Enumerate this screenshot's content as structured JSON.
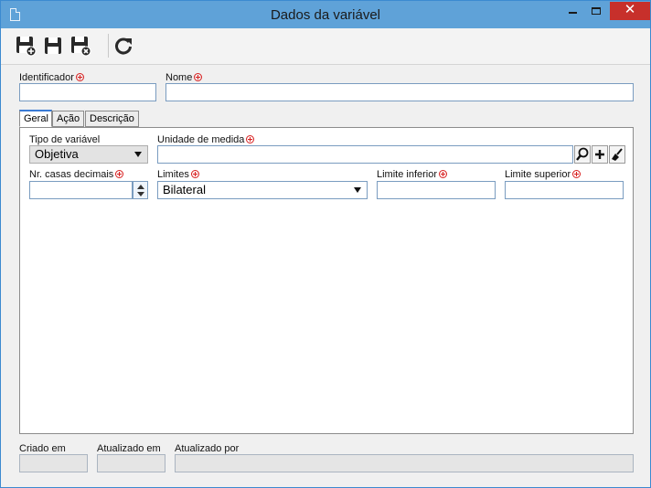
{
  "window": {
    "title": "Dados da variável"
  },
  "toolbar": {
    "icons": [
      "save-new-icon",
      "save-icon",
      "save-close-icon",
      "refresh-icon"
    ]
  },
  "header": {
    "identificador_label": "Identificador",
    "identificador_value": "",
    "nome_label": "Nome",
    "nome_value": ""
  },
  "tabs": [
    {
      "label": "Geral",
      "active": true
    },
    {
      "label": "Ação",
      "active": false
    },
    {
      "label": "Descrição",
      "active": false
    }
  ],
  "geral": {
    "tipo_label": "Tipo de variável",
    "tipo_value": "Objetiva",
    "unidade_label": "Unidade de medida",
    "unidade_value": "",
    "casas_label": "Nr. casas decimais",
    "casas_value": "",
    "limites_label": "Limites",
    "limites_value": "Bilateral",
    "limite_inferior_label": "Limite inferior",
    "limite_inferior_value": "",
    "limite_superior_label": "Limite superior",
    "limite_superior_value": ""
  },
  "footer": {
    "criado_label": "Criado em",
    "atualizado_em_label": "Atualizado em",
    "atualizado_por_label": "Atualizado por"
  },
  "colors": {
    "accent": "#3a7bd5",
    "titlebar": "#5fa2d8",
    "close": "#c7302b",
    "required": "#d81e1e"
  }
}
